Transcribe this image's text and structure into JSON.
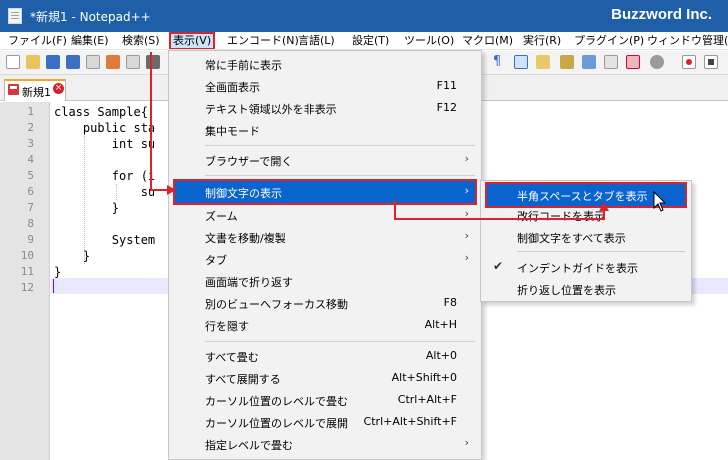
{
  "window": {
    "title": "*新規1 - Notepad++",
    "brand": "Buzzword Inc."
  },
  "menubar": {
    "items": [
      "ファイル(F)",
      "編集(E)",
      "検索(S)",
      "表示(V)",
      "エンコード(N)",
      "言語(L)",
      "設定(T)",
      "ツール(O)",
      "マクロ(M)",
      "実行(R)",
      "プラグイン(P)",
      "ウィンドウ管理(W)"
    ],
    "active": "表示(V)"
  },
  "tab": {
    "label": "新規1",
    "close_glyph": "×"
  },
  "editor": {
    "line_numbers": [
      "1",
      "2",
      "3",
      "4",
      "5",
      "6",
      "7",
      "8",
      "9",
      "10",
      "11",
      "12"
    ],
    "lines": [
      "class Sample{",
      "    public sta",
      "        int su",
      "",
      "        for (i",
      "            su",
      "        }",
      "",
      "        System",
      "    }",
      "}",
      ""
    ],
    "current_line": "12"
  },
  "view_menu": {
    "items": [
      {
        "label": "常に手前に表示",
        "shortcut": "",
        "submenu": false
      },
      {
        "label": "全画面表示",
        "shortcut": "F11",
        "submenu": false
      },
      {
        "label": "テキスト領域以外を非表示",
        "shortcut": "F12",
        "submenu": false
      },
      {
        "label": "集中モード",
        "shortcut": "",
        "submenu": false
      },
      {
        "label": "ブラウザーで開く",
        "shortcut": "",
        "submenu": true
      },
      {
        "label": "制御文字の表示",
        "shortcut": "",
        "submenu": true,
        "highlighted": true
      },
      {
        "label": "ズーム",
        "shortcut": "",
        "submenu": true
      },
      {
        "label": "文書を移動/複製",
        "shortcut": "",
        "submenu": true
      },
      {
        "label": "タブ",
        "shortcut": "",
        "submenu": true
      },
      {
        "label": "画面端で折り返す",
        "shortcut": "",
        "submenu": false
      },
      {
        "label": "別のビューへフォーカス移動",
        "shortcut": "F8",
        "submenu": false
      },
      {
        "label": "行を隠す",
        "shortcut": "Alt+H",
        "submenu": false
      },
      {
        "label": "すべて畳む",
        "shortcut": "Alt+0",
        "submenu": false
      },
      {
        "label": "すべて展開する",
        "shortcut": "Alt+Shift+0",
        "submenu": false
      },
      {
        "label": "カーソル位置のレベルで畳む",
        "shortcut": "Ctrl+Alt+F",
        "submenu": false
      },
      {
        "label": "カーソル位置のレベルで展開",
        "shortcut": "Ctrl+Alt+Shift+F",
        "submenu": false
      },
      {
        "label": "指定レベルで畳む",
        "shortcut": "",
        "submenu": true
      }
    ],
    "submenu_arrow": "›"
  },
  "control_chars_submenu": {
    "items": [
      {
        "label": "半角スペースとタブを表示",
        "checked": false,
        "highlighted": true
      },
      {
        "label": "改行コードを表示",
        "checked": false
      },
      {
        "label": "制御文字をすべて表示",
        "checked": false
      },
      {
        "label": "インデントガイドを表示",
        "checked": true
      },
      {
        "label": "折り返し位置を表示",
        "checked": false
      }
    ],
    "check_glyph": "✔"
  },
  "colors": {
    "titlebar": "#1e5fa8",
    "menu_highlight": "#0a64d0",
    "annotation_red": "#d9232d",
    "gutter": "#e4e4e4",
    "current_line": "#e8e8ff"
  }
}
